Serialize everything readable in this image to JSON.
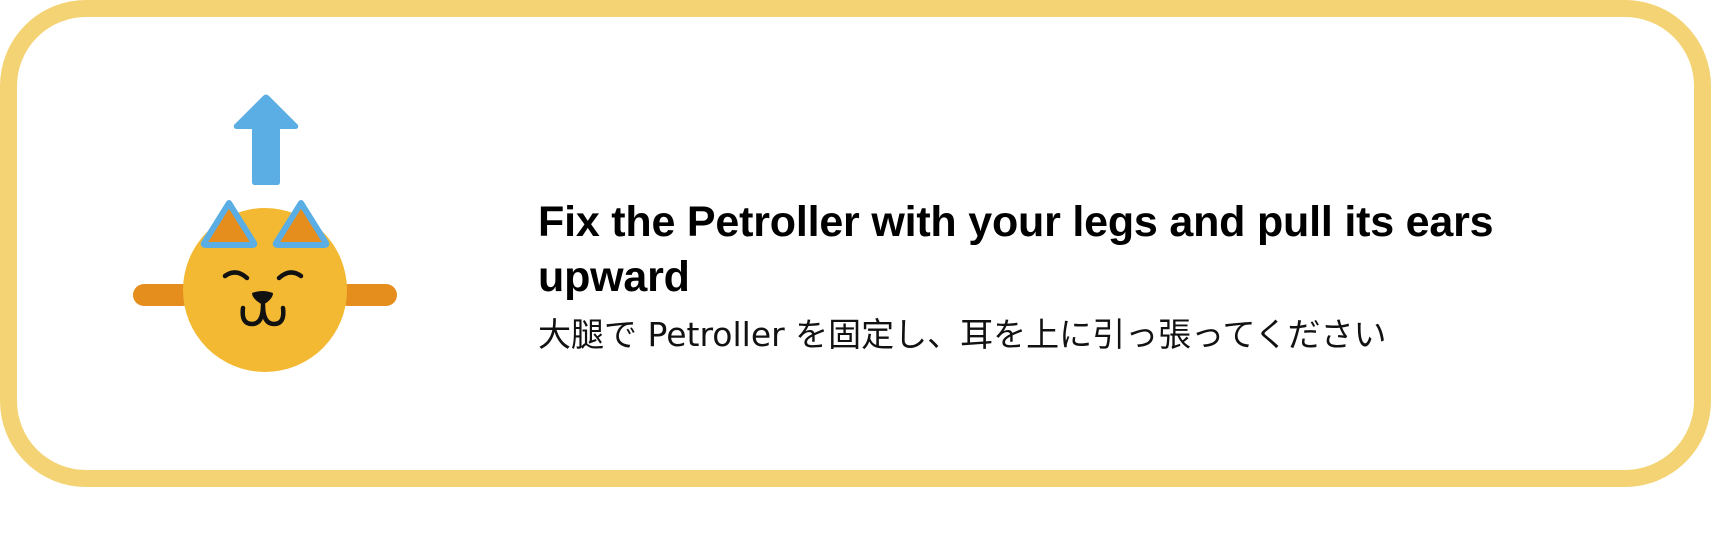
{
  "instruction": {
    "title": "Fix the Petroller with your legs and pull its ears upward",
    "subtitle": "大腿で Petroller を固定し、耳を上に引っ張ってください"
  },
  "illustration": {
    "icons": [
      "arrow-up-icon",
      "cat-face-icon"
    ],
    "colors": {
      "arrow": "#5AAEE3",
      "face": "#F3B933",
      "ears": "#E58E1E",
      "ear_outline": "#5AAEE3",
      "whiskers": "#E58E1E",
      "features": "#111111"
    }
  },
  "theme": {
    "border": "#F3D373",
    "background": "#FFFFFF"
  }
}
